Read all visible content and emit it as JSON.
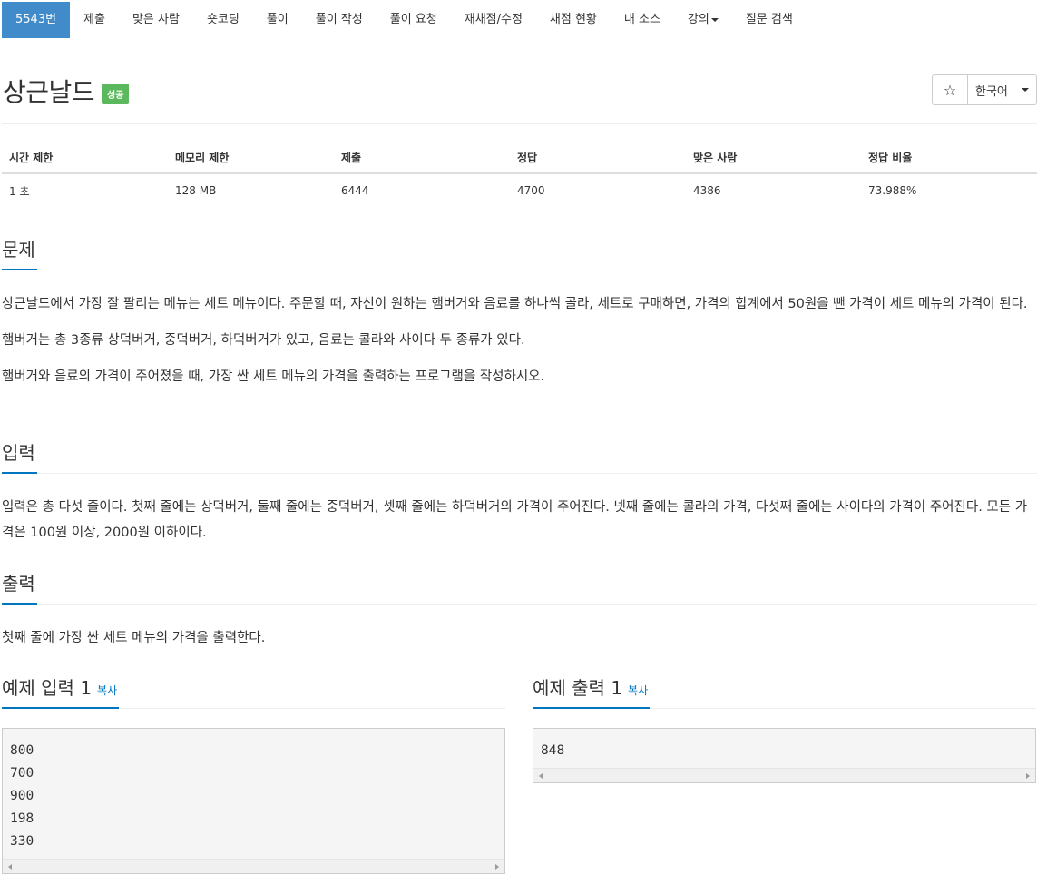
{
  "nav": {
    "tabs": [
      {
        "label": "5543번"
      },
      {
        "label": "제출"
      },
      {
        "label": "맞은 사람"
      },
      {
        "label": "숏코딩"
      },
      {
        "label": "풀이"
      },
      {
        "label": "풀이 작성"
      },
      {
        "label": "풀이 요청"
      },
      {
        "label": "재채점/수정"
      },
      {
        "label": "채점 현황"
      },
      {
        "label": "내 소스"
      },
      {
        "label": "강의"
      },
      {
        "label": "질문 검색"
      }
    ]
  },
  "problem": {
    "title": "상근날드",
    "badge": "성공",
    "star_icon": "☆",
    "language": "한국어"
  },
  "stats": {
    "headers": [
      "시간 제한",
      "메모리 제한",
      "제출",
      "정답",
      "맞은 사람",
      "정답 비율"
    ],
    "values": [
      "1 초",
      "128 MB",
      "6444",
      "4700",
      "4386",
      "73.988%"
    ]
  },
  "sections": {
    "problem_title": "문제",
    "problem_p1": "상근날드에서 가장 잘 팔리는 메뉴는 세트 메뉴이다. 주문할 때, 자신이 원하는 햄버거와 음료를 하나씩 골라, 세트로 구매하면, 가격의 합계에서 50원을 뺀 가격이 세트 메뉴의 가격이 된다.",
    "problem_p2": "햄버거는 총 3종류 상덕버거, 중덕버거, 하덕버거가 있고, 음료는 콜라와 사이다 두 종류가 있다.",
    "problem_p3": "햄버거와 음료의 가격이 주어졌을 때, 가장 싼 세트 메뉴의 가격을 출력하는 프로그램을 작성하시오.",
    "input_title": "입력",
    "input_p": "입력은 총 다섯 줄이다. 첫째 줄에는 상덕버거, 둘째 줄에는 중덕버거, 셋째 줄에는 하덕버거의 가격이 주어진다. 넷째 줄에는 콜라의 가격, 다섯째 줄에는 사이다의 가격이 주어진다. 모든 가격은 100원 이상, 2000원 이하이다.",
    "output_title": "출력",
    "output_p": "첫째 줄에 가장 싼 세트 메뉴의 가격을 출력한다."
  },
  "samples": {
    "input_title": "예제 입력 1",
    "output_title": "예제 출력 1",
    "copy_label": "복사",
    "input_text": "800\n700\n900\n198\n330",
    "output_text": "848"
  }
}
